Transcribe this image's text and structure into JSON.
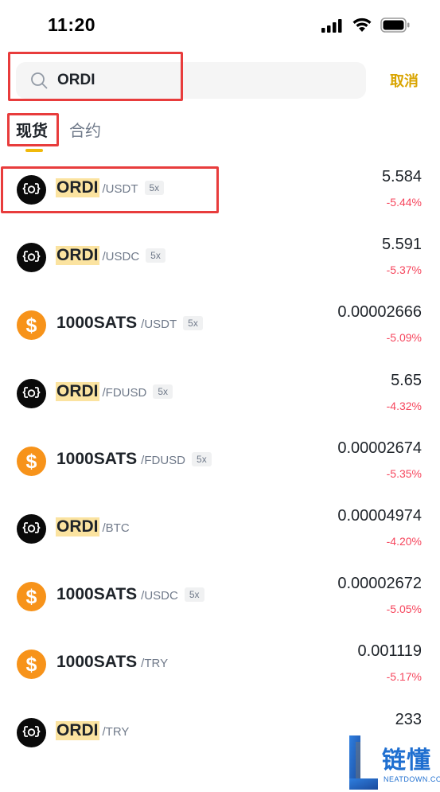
{
  "status_bar": {
    "time": "11:20",
    "icons": [
      "signal-icon",
      "wifi-icon",
      "battery-icon"
    ]
  },
  "search": {
    "value": "ORDI",
    "placeholder": "",
    "cancel_label": "取消"
  },
  "tabs": [
    {
      "label": "现货",
      "active": true
    },
    {
      "label": "合约",
      "active": false
    }
  ],
  "colors": {
    "accent": "#f0b90b",
    "negative": "#f6465d",
    "highlight": "#fbe3a0",
    "annotation": "#e83c3c"
  },
  "markets": [
    {
      "base": "ORDI",
      "quote": "/USDT",
      "leverage": "5x",
      "price": "5.584",
      "change": "-5.44%",
      "logo": "ordi-logo-icon"
    },
    {
      "base": "ORDI",
      "quote": "/USDC",
      "leverage": "5x",
      "price": "5.591",
      "change": "-5.37%",
      "logo": "ordi-logo-icon"
    },
    {
      "base": "1000SATS",
      "quote": "/USDT",
      "leverage": "5x",
      "price": "0.00002666",
      "change": "-5.09%",
      "logo": "sats-logo-icon"
    },
    {
      "base": "ORDI",
      "quote": "/FDUSD",
      "leverage": "5x",
      "price": "5.65",
      "change": "-4.32%",
      "logo": "ordi-logo-icon"
    },
    {
      "base": "1000SATS",
      "quote": "/FDUSD",
      "leverage": "5x",
      "price": "0.00002674",
      "change": "-5.35%",
      "logo": "sats-logo-icon"
    },
    {
      "base": "ORDI",
      "quote": "/BTC",
      "leverage": "",
      "price": "0.00004974",
      "change": "-4.20%",
      "logo": "ordi-logo-icon"
    },
    {
      "base": "1000SATS",
      "quote": "/USDC",
      "leverage": "5x",
      "price": "0.00002672",
      "change": "-5.05%",
      "logo": "sats-logo-icon"
    },
    {
      "base": "1000SATS",
      "quote": "/TRY",
      "leverage": "",
      "price": "0.001119",
      "change": "-5.17%",
      "logo": "sats-logo-icon"
    },
    {
      "base": "ORDI",
      "quote": "/TRY",
      "leverage": "",
      "price": "233",
      "change": "",
      "logo": "ordi-logo-icon"
    }
  ],
  "watermark": {
    "text": "链懂",
    "subtext": "NEATDOWN.COM"
  }
}
